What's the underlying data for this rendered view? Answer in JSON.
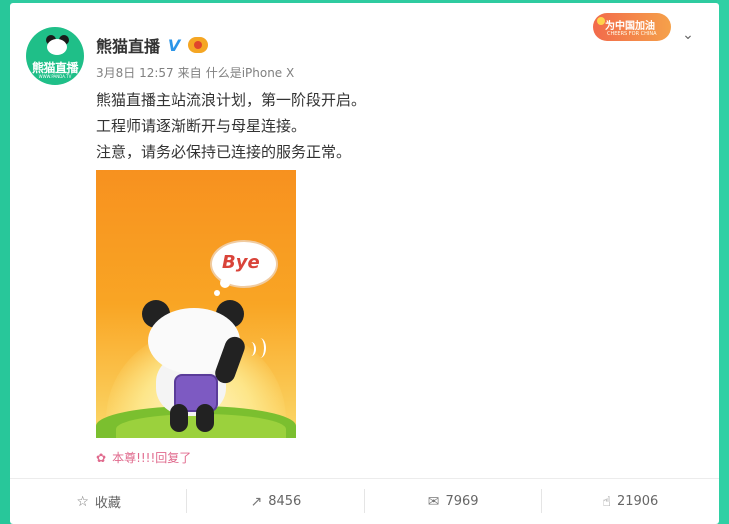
{
  "post": {
    "author": "熊猫直播",
    "avatar_text": "熊猫直播",
    "avatar_sub": "WWW.PANDA.TV",
    "meta": {
      "date": "3月8日 12:57",
      "from_label": "来自",
      "device": "什么是iPhone X"
    },
    "lines": [
      "熊猫直播主站流浪计划，第一阶段开启。",
      "工程师请逐渐断开与母星连接。",
      "注意，请务必保持已连接的服务正常。"
    ],
    "image_caption": "Bye",
    "source_text": "本尊!!!!回复了"
  },
  "badge": {
    "text": "为中国加油",
    "sub": "CHEERS FOR CHINA"
  },
  "actions": {
    "favorite_label": "收藏",
    "repost_count": "8456",
    "comment_count": "7969",
    "like_count": "21906"
  },
  "icons": {
    "verified": "verified-icon",
    "vip": "vip-icon",
    "menu": "chevron-down-icon",
    "favorite": "star-icon",
    "repost": "share-icon",
    "comment": "comment-icon",
    "like": "thumbs-up-icon",
    "source": "flower-icon"
  },
  "colors": {
    "background": "#2ecba0",
    "accent_verified": "#2b95e8",
    "source_pink": "#e06a8d"
  }
}
